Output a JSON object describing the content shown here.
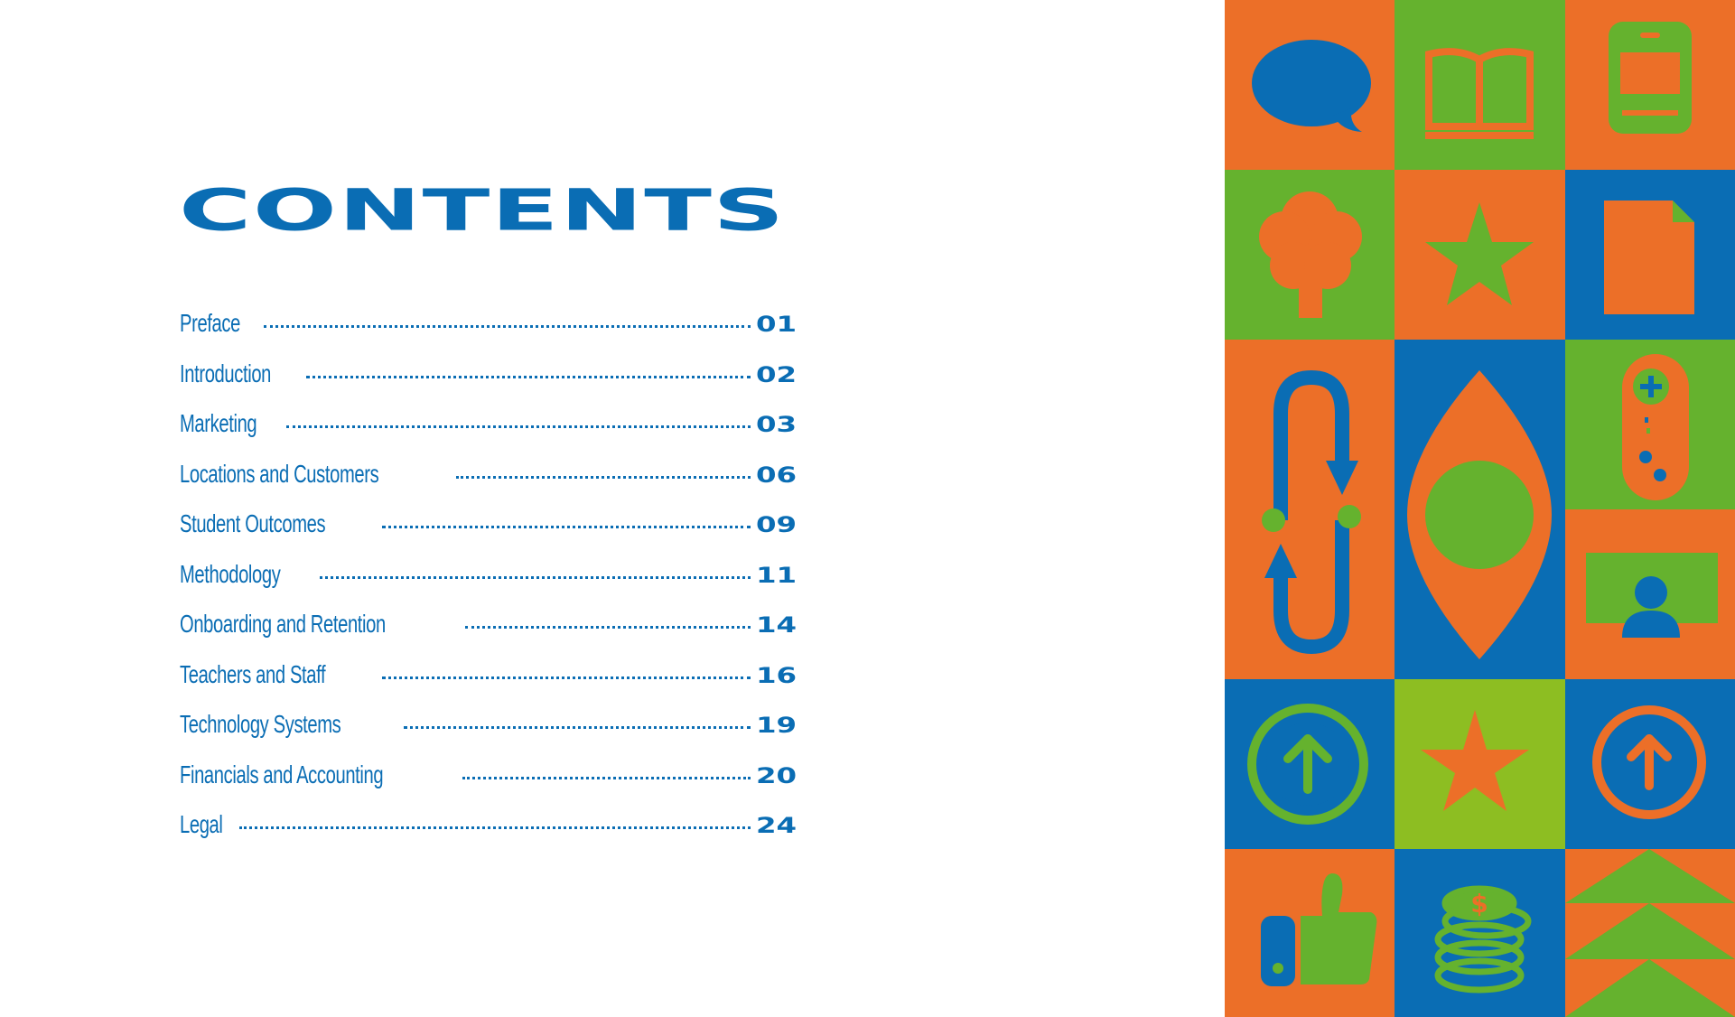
{
  "title": "CONTENTS",
  "toc": [
    {
      "label": "Preface",
      "page": "01"
    },
    {
      "label": "Introduction",
      "page": "02"
    },
    {
      "label": "Marketing",
      "page": "03"
    },
    {
      "label": "Locations and Customers",
      "page": "06"
    },
    {
      "label": "Student Outcomes",
      "page": "09"
    },
    {
      "label": "Methodology",
      "page": "11"
    },
    {
      "label": "Onboarding and Retention",
      "page": "14"
    },
    {
      "label": "Teachers and Staff",
      "page": "16"
    },
    {
      "label": "Technology Systems",
      "page": "19"
    },
    {
      "label": "Financials and Accounting",
      "page": "20"
    },
    {
      "label": "Legal",
      "page": "24"
    }
  ],
  "colors": {
    "blue": "#0A6DB4",
    "orange": "#EC6F28",
    "green": "#65B22E",
    "lime": "#8DBE22"
  },
  "mosaic_icons": [
    "speech-bubble-icon",
    "open-book-icon",
    "smartphone-icon",
    "tree-icon",
    "star-icon",
    "document-icon",
    "cycle-arrows-icon",
    "eye-icon",
    "gamepad-icon",
    "id-card-icon",
    "up-arrow-circle-icon",
    "star-icon",
    "up-arrow-circle-icon",
    "thumbs-up-icon",
    "coins-icon",
    "triangles-icon"
  ]
}
